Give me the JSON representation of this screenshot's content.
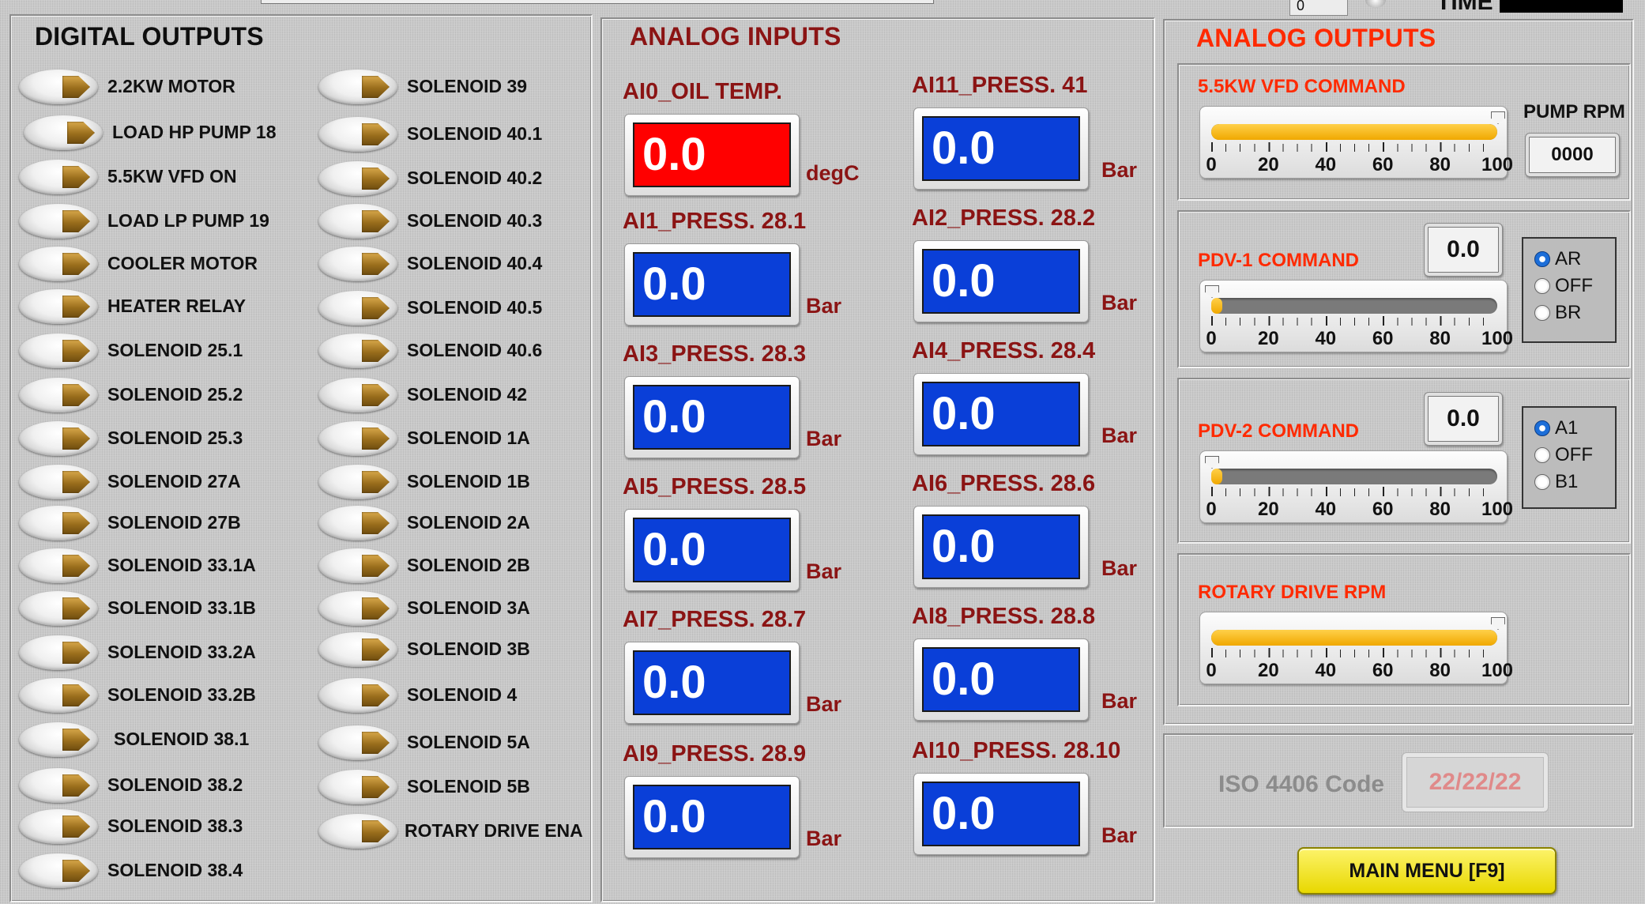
{
  "top_bar": {
    "small_value": "0",
    "time_label": "TIME"
  },
  "digital_outputs": {
    "title": "DIGITAL OUTPUTS",
    "left_column": [
      "2.2KW MOTOR",
      "LOAD HP PUMP 18",
      "5.5KW VFD ON",
      "LOAD LP PUMP 19",
      "COOLER MOTOR",
      "HEATER RELAY",
      "SOLENOID 25.1",
      "SOLENOID 25.2",
      "SOLENOID 25.3",
      "SOLENOID 27A",
      "SOLENOID 27B",
      "SOLENOID 33.1A",
      "SOLENOID 33.1B",
      "SOLENOID 33.2A",
      "SOLENOID 33.2B",
      "SOLENOID 38.1",
      "SOLENOID 38.2",
      "SOLENOID 38.3",
      "SOLENOID 38.4"
    ],
    "right_column": [
      "SOLENOID 39",
      "SOLENOID 40.1",
      "SOLENOID 40.2",
      "SOLENOID 40.3",
      "SOLENOID 40.4",
      "SOLENOID 40.5",
      "SOLENOID 40.6",
      "SOLENOID 42",
      "SOLENOID 1A",
      "SOLENOID 1B",
      "SOLENOID 2A",
      "SOLENOID 2B",
      "SOLENOID 3A",
      "SOLENOID 3B",
      "SOLENOID 4",
      "SOLENOID 5A",
      "SOLENOID 5B",
      "ROTARY DRIVE ENA"
    ]
  },
  "analog_inputs": {
    "title": "ANALOG INPUTS",
    "channels": [
      {
        "label": "AI0_OIL TEMP.",
        "value": "0.0",
        "unit": "degC",
        "alarm": true
      },
      {
        "label": "AI11_PRESS. 41",
        "value": "0.0",
        "unit": "Bar",
        "alarm": false
      },
      {
        "label": "AI1_PRESS. 28.1",
        "value": "0.0",
        "unit": "Bar",
        "alarm": false
      },
      {
        "label": "AI2_PRESS. 28.2",
        "value": "0.0",
        "unit": "Bar",
        "alarm": false
      },
      {
        "label": "AI3_PRESS. 28.3",
        "value": "0.0",
        "unit": "Bar",
        "alarm": false
      },
      {
        "label": "AI4_PRESS. 28.4",
        "value": "0.0",
        "unit": "Bar",
        "alarm": false
      },
      {
        "label": "AI5_PRESS. 28.5",
        "value": "0.0",
        "unit": "Bar",
        "alarm": false
      },
      {
        "label": "AI6_PRESS. 28.6",
        "value": "0.0",
        "unit": "Bar",
        "alarm": false
      },
      {
        "label": "AI7_PRESS. 28.7",
        "value": "0.0",
        "unit": "Bar",
        "alarm": false
      },
      {
        "label": "AI8_PRESS. 28.8",
        "value": "0.0",
        "unit": "Bar",
        "alarm": false
      },
      {
        "label": "AI9_PRESS. 28.9",
        "value": "0.0",
        "unit": "Bar",
        "alarm": false
      },
      {
        "label": "AI10_PRESS. 28.10",
        "value": "0.0",
        "unit": "Bar",
        "alarm": false
      }
    ]
  },
  "analog_outputs": {
    "title": "ANALOG OUTPUTS",
    "scale_labels": [
      "0",
      "20",
      "40",
      "60",
      "80",
      "100"
    ],
    "vfd": {
      "label": "5.5KW VFD COMMAND",
      "value_percent": 100,
      "pump_rpm_label": "PUMP RPM",
      "pump_rpm": "0000"
    },
    "pdv1": {
      "label": "PDV-1 COMMAND",
      "value_percent": 0,
      "readout": "0.0",
      "options": [
        "AR",
        "OFF",
        "BR"
      ],
      "selected": "AR"
    },
    "pdv2": {
      "label": "PDV-2 COMMAND",
      "value_percent": 0,
      "readout": "0.0",
      "options": [
        "A1",
        "OFF",
        "B1"
      ],
      "selected": "A1"
    },
    "rotary": {
      "label": "ROTARY DRIVE RPM",
      "value_percent": 100
    }
  },
  "iso": {
    "label": "ISO 4406 Code",
    "value": "22/22/22"
  },
  "main_menu": {
    "label": "MAIN MENU [F9]"
  },
  "colors": {
    "indicator_blue": "#0a3fd8",
    "alarm_red": "#ff0000",
    "title_red": "#8b1414",
    "ao_orange": "#ff2a00",
    "slider_fill": "#f0a800",
    "button_yellow": "#f5e520"
  }
}
